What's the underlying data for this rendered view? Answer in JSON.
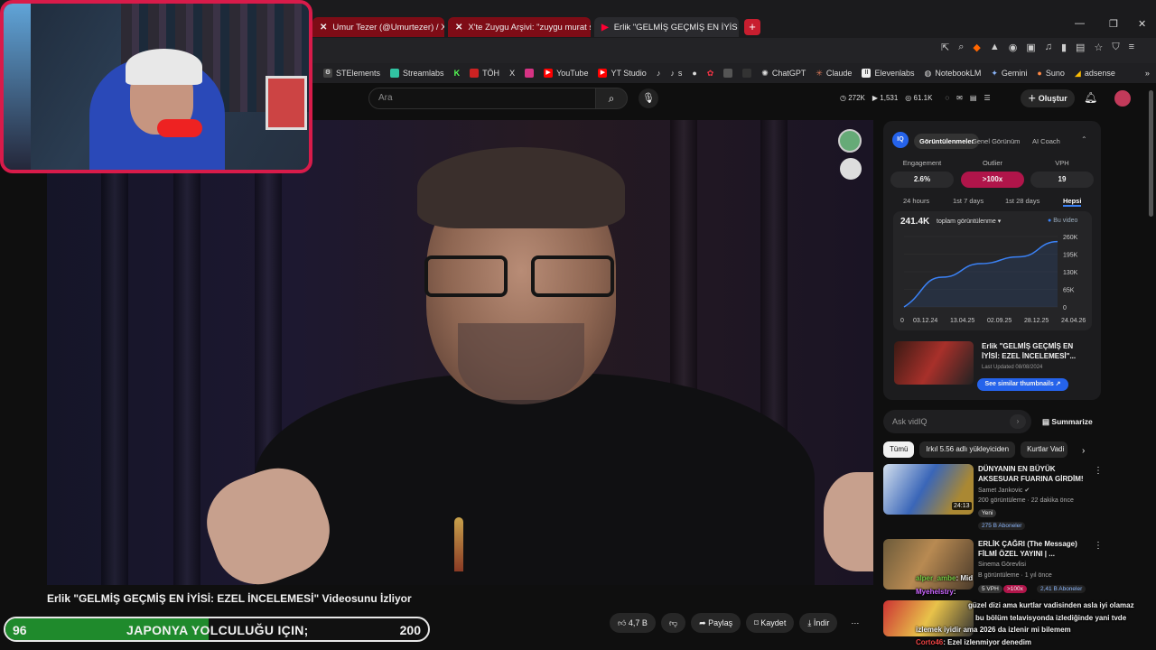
{
  "browser": {
    "tabs": [
      {
        "label": "Umur Tezer (@Umurtezer) / X",
        "icon": "x-icon"
      },
      {
        "label": "X'te Zuygu Arşivi: \"zuygu murat sonr",
        "icon": "x-icon"
      },
      {
        "label": "Erlik \"GELMİŞ GEÇMİŞ EN İYİS",
        "icon": "youtube-icon"
      }
    ],
    "new_tab": "+",
    "bookmarks": [
      "STElements",
      "Streamlabs",
      "K",
      "TÖH",
      "X",
      "",
      "YouTube",
      "YT Studio",
      "",
      "s",
      "",
      "",
      "",
      "",
      "ChatGPT",
      "Claude",
      "Elevenlabs",
      "NotebookLM",
      "Gemini",
      "Suno",
      "adsense"
    ],
    "more": "»"
  },
  "youtube": {
    "search_placeholder": "Ara",
    "stats": [
      "272K",
      "1,531",
      "61.1K"
    ],
    "create_label": "Oluştur",
    "video_title": "Erlik \"GELMİŞ GEÇMİŞ EN İYİSİ: EZEL İNCELEMESİ\" Videosunu İzliyor",
    "actions": {
      "like": "4,7 B",
      "dislike": "",
      "share": "Paylaş",
      "save": "Kaydet",
      "download": "İndir",
      "more": "⋯"
    }
  },
  "vidiq": {
    "tabs": [
      "Görüntülenmeler",
      "Genel Görünüm",
      "AI Coach"
    ],
    "metrics": [
      {
        "label": "Engagement",
        "value": "2.6%"
      },
      {
        "label": "Outlier",
        "value": ">100x"
      },
      {
        "label": "VPH",
        "value": "19"
      }
    ],
    "ranges": [
      "24 hours",
      "1st 7 days",
      "1st 28 days",
      "Hepsi"
    ],
    "views": "241.4K",
    "view_select": "toplam görüntülenme",
    "legend": "Bu video",
    "rec_title": "Erlik \"GELMİŞ GEÇMİŞ EN İYİSİ: EZEL İNCELEMESİ\"...",
    "rec_date": "Last Updated 08/08/2024",
    "similar_btn": "See similar thumbnails",
    "ask_placeholder": "Ask vidIQ",
    "summarize": "Summarize"
  },
  "chart_data": {
    "type": "area",
    "x": [
      "03.12.24",
      "13.04.25",
      "02.09.25",
      "28.12.25",
      "24.04.26"
    ],
    "y_ticks": [
      "0",
      "65K",
      "130K",
      "195K",
      "260K"
    ],
    "series": [
      {
        "name": "Bu video",
        "values": [
          0,
          110000,
          160000,
          185000,
          241400
        ]
      }
    ],
    "ylim": [
      0,
      260000
    ],
    "color": "#3b82f6"
  },
  "chips": [
    "Tümü",
    "Irkıl 5.56 adlı yükleyiciden",
    "Kurtlar Vadi"
  ],
  "related": [
    {
      "title": "DÜNYANIN EN BÜYÜK AKSESUAR FUARINA GİRDİM! ...",
      "channel": "Samet Jankovic",
      "meta": "200 görüntüleme · 22 dakika önce",
      "badge": "Yeni",
      "duration": "24:13",
      "subs": "275 B Aboneler"
    },
    {
      "title": "ERLİK ÇAĞRI (The Message) FİLMİ ÖZEL YAYINI | ...",
      "channel": "Sinema Görevlisi",
      "meta": "B görüntüleme · 1 yıl önce",
      "badge": "5 VPH",
      "outlier": ">100x",
      "subs": "2,41 B Aboneler"
    }
  ],
  "chat": [
    {
      "user": "alper_ambe",
      "msg": ": Mid"
    },
    {
      "user": "Myehelstry",
      "msg": ":"
    },
    {
      "user": "",
      "msg": "güzel dizi ama kurtlar vadisinden asla iyi olamaz"
    },
    {
      "user": "",
      "msg": "bu bölüm telavisyonda izlediğinde yani tvde"
    },
    {
      "user": "",
      "msg": "izlemek iyidir ama 2026 da izlenir mi bilemem"
    },
    {
      "user": "Corto46",
      "msg": ": Ezel izlenmiyor denedim"
    }
  ],
  "hud": {
    "left": "96",
    "text": "JAPONYA YOLCULUĞU IÇIN;",
    "right": "200",
    "progress": 0.48
  }
}
